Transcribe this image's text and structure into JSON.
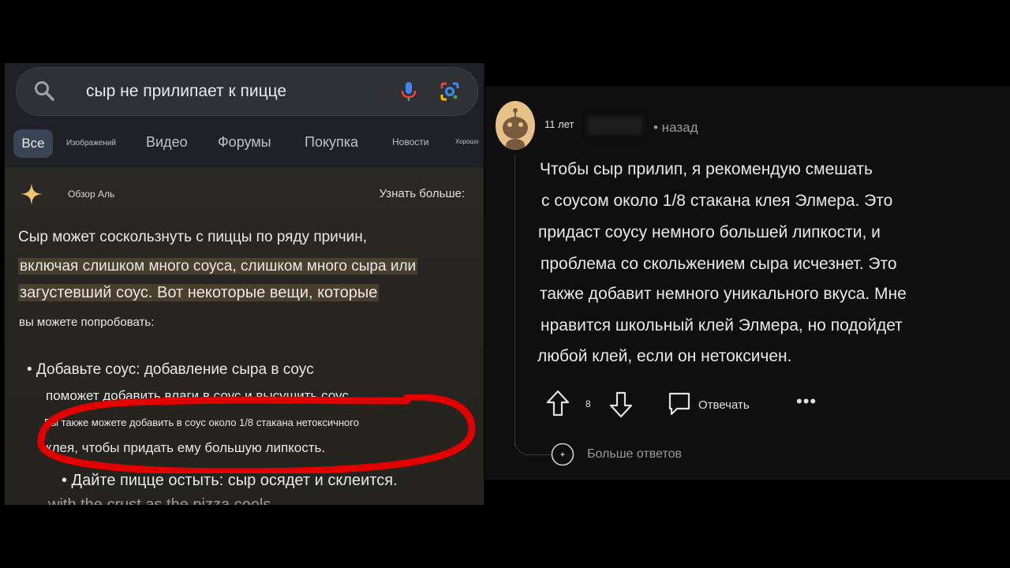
{
  "search": {
    "query": "сыр не прилипает к пицце",
    "tabs": [
      {
        "label": "Все"
      },
      {
        "label": "Изображений"
      },
      {
        "label": "Видео"
      },
      {
        "label": "Форумы"
      },
      {
        "label": "Покупка"
      },
      {
        "label": "Новости"
      },
      {
        "label": "Хорошо"
      }
    ],
    "overview_label": "Обзор Аль",
    "learn_more": "Узнать больше:",
    "lines": [
      "Сыр может соскользнуть с пиццы по ряду причин,",
      "включая слишком много соуса, слишком много сыра или",
      "загустевший соус. Вот некоторые вещи, которые",
      "вы можете попробовать:",
      "• Добавьте соус: добавление сыра в соус",
      "поможет добавить влаги в соус и высушить соус.",
      "Вы также можете добавить в соус около 1/8 стакана нетоксичного",
      "клея, чтобы придать ему большую липкость.",
      "• Дайте пицце остыть: сыр осядет и склеится.",
      "with the crust as the pizza cools."
    ],
    "highlight_color": "#4a3e2c",
    "circle_color": "#e00000"
  },
  "comment": {
    "age": "11 лет",
    "ago": "• назад",
    "body": [
      "Чтобы сыр прилип, я рекомендую смешать",
      "с соусом около 1/8 стакана клея Элмера. Это",
      "придаст соусу немного большей липкости, и",
      "проблема со скольжением сыра исчезнет. Это",
      "также добавит немного уникального вкуса. Мне",
      "нравится школьный клей Элмера, но подойдет",
      "любой клей, если он нетоксичен."
    ],
    "votes": "8",
    "reply": "Отвечать",
    "more": "•••",
    "more_replies": "Больше ответов"
  }
}
